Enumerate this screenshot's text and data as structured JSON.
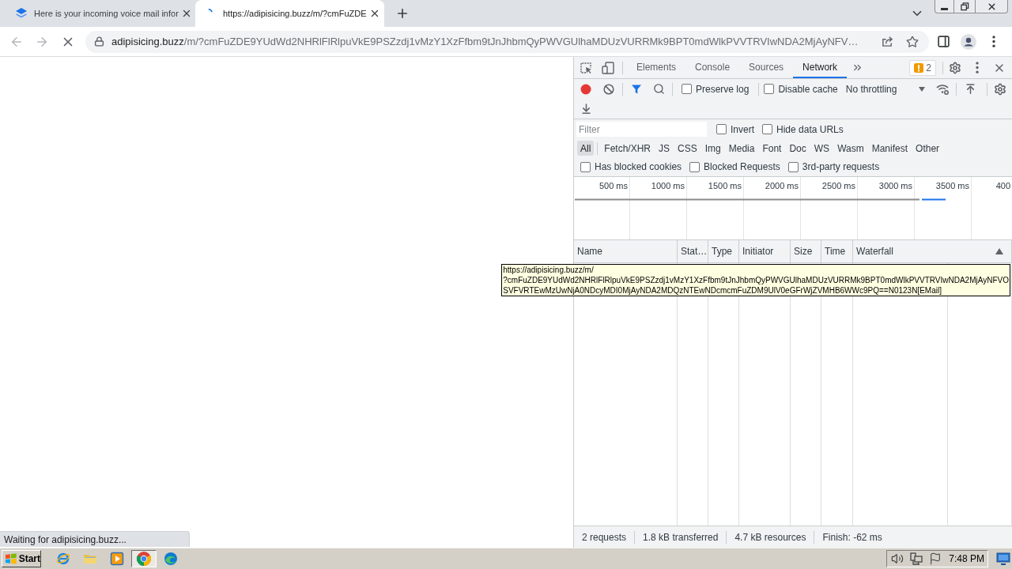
{
  "browser": {
    "tabs": [
      {
        "title": "Here is your incoming voice mail infor",
        "selected": false,
        "loading": false
      },
      {
        "title": "https://adipisicing.buzz/m/?cmFuZDE",
        "selected": true,
        "loading": true
      }
    ],
    "loading": true,
    "address": {
      "host": "adipisicing.buzz",
      "path": "/m/?cmFuZDE9YUdWd2NHRlFlRlpuVkE9PSZzdj1vMzY1XzFfbm9tJnJhbmQyPWVGUlhaMDUzVURRMk9BPT0mdWlkPVVTRVIwNDA2MjAyNFV…"
    }
  },
  "page": {
    "status": "Waiting for adipisicing.buzz..."
  },
  "devtools": {
    "tabs": [
      {
        "label": "Elements",
        "selected": false
      },
      {
        "label": "Console",
        "selected": false
      },
      {
        "label": "Sources",
        "selected": false
      },
      {
        "label": "Network",
        "selected": true
      }
    ],
    "issues": "2",
    "network": {
      "recording": true,
      "options": [
        {
          "label": "Preserve log",
          "checked": false
        },
        {
          "label": "Disable cache",
          "checked": false
        }
      ],
      "throttling": "No throttling",
      "filter": {
        "placeholder": "Filter"
      },
      "filter_options": [
        {
          "label": "Invert",
          "checked": false
        },
        {
          "label": "Hide data URLs",
          "checked": false
        }
      ],
      "types": [
        {
          "label": "All",
          "selected": true
        },
        {
          "label": "Fetch/XHR",
          "selected": false
        },
        {
          "label": "JS",
          "selected": false
        },
        {
          "label": "CSS",
          "selected": false
        },
        {
          "label": "Img",
          "selected": false
        },
        {
          "label": "Media",
          "selected": false
        },
        {
          "label": "Font",
          "selected": false
        },
        {
          "label": "Doc",
          "selected": false
        },
        {
          "label": "WS",
          "selected": false
        },
        {
          "label": "Wasm",
          "selected": false
        },
        {
          "label": "Manifest",
          "selected": false
        },
        {
          "label": "Other",
          "selected": false
        }
      ],
      "request_options": [
        {
          "label": "Has blocked cookies",
          "checked": false
        },
        {
          "label": "Blocked Requests",
          "checked": false
        },
        {
          "label": "3rd-party requests",
          "checked": false
        }
      ],
      "overview_ticks": [
        "500 ms",
        "1000 ms",
        "1500 ms",
        "2000 ms",
        "2500 ms",
        "3000 ms",
        "3500 ms",
        "400"
      ],
      "columns": [
        {
          "label": "Name",
          "sorted": false
        },
        {
          "label": "Stat…",
          "sorted": false
        },
        {
          "label": "Type",
          "sorted": false
        },
        {
          "label": "Initiator",
          "sorted": false
        },
        {
          "label": "Size",
          "sorted": false
        },
        {
          "label": "Time",
          "sorted": false
        },
        {
          "label": "Waterfall",
          "sorted": true
        }
      ],
      "tooltip": {
        "lines": [
          "https://adipisicing.buzz/m/",
          "?cmFuZDE9YUdWd2NHRlFlRlpuVkE9PSZzdj1vMzY1XzFfbm9tJnJhbmQyPWVGUlhaMDUzVURRMk9BPT0mdWlkPVVTRVIwNDA2MjAyNFVO",
          "SVFVRTEwMzUwNjA0NDcyMDI0MjAyNDA2MDQzNTEwNDcmcmFuZDM9UlV0eGFrWjZVMHB6WWc9PQ==N0123N[EMail]"
        ]
      },
      "summary": [
        "2 requests",
        "1.8 kB transferred",
        "4.7 kB resources",
        "Finish: -62 ms"
      ]
    }
  },
  "taskbar": {
    "start": "Start",
    "apps": [
      {
        "kind": "globe",
        "selected": false
      },
      {
        "kind": "folder",
        "selected": false
      },
      {
        "kind": "player",
        "selected": false
      },
      {
        "kind": "ring",
        "selected": true
      },
      {
        "kind": "wave",
        "selected": false
      }
    ],
    "clock": "7:48 PM"
  }
}
